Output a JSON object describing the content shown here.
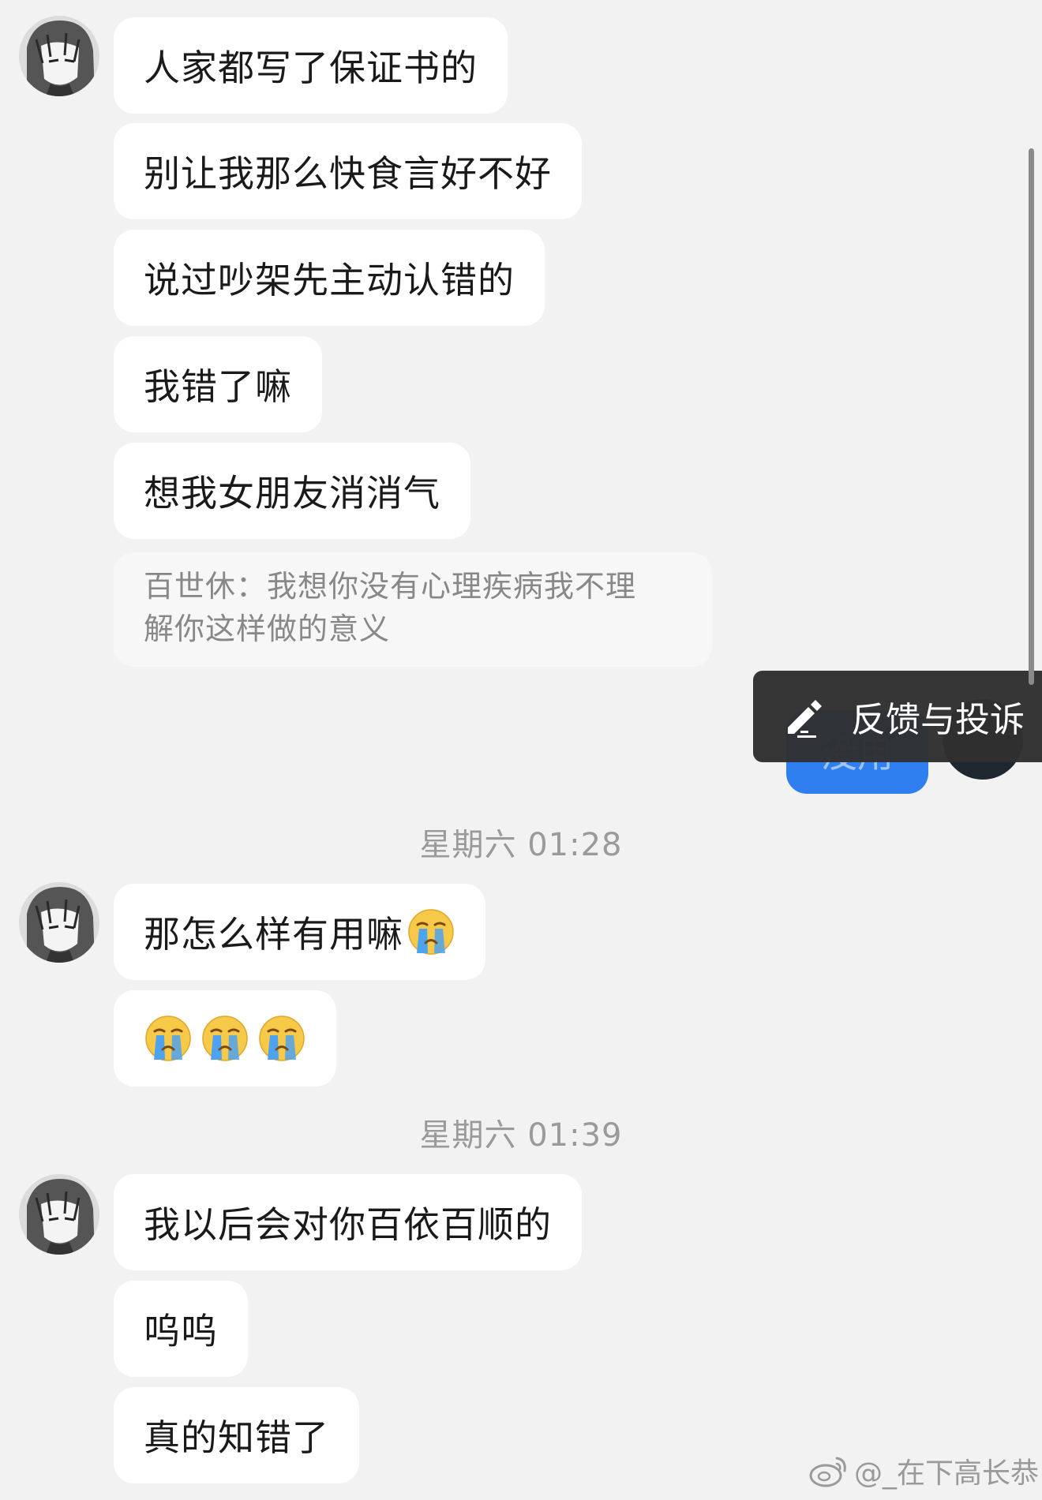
{
  "messages_group1": [
    "人家都写了保证书的",
    "别让我那么快食言好不好",
    "说过吵架先主动认错的",
    "我错了嘛",
    "想我女朋友消消气"
  ],
  "quote": {
    "line1": "百世休：我想你没有心理疾病我不理",
    "line2": "解你这样做的意义"
  },
  "sent_message": "没用",
  "context_menu": {
    "feedback_label": "反馈与投诉",
    "icon": "pen-icon"
  },
  "timestamp1": "星期六 01:28",
  "messages_group2": [
    "那怎么样有用嘛",
    ""
  ],
  "emoji_name": "loudly-crying-face",
  "timestamp2": "星期六 01:39",
  "messages_group3": [
    "我以后会对你百依百顺的",
    "呜呜",
    "真的知错了"
  ],
  "watermark": "@_在下高长恭",
  "colors": {
    "background": "#f2f2f2",
    "incoming_bubble": "#ffffff",
    "outgoing_bubble": "#2f7ff0",
    "timestamp_text": "#9a9a9a",
    "quote_text": "#888888"
  }
}
